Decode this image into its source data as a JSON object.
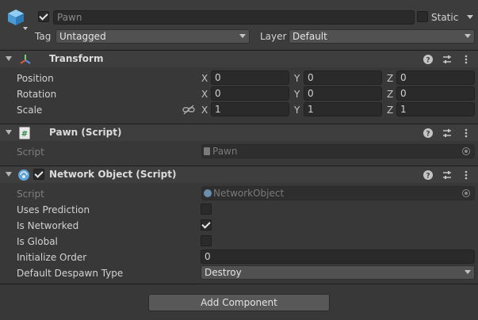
{
  "gameobject": {
    "name": "Pawn",
    "active": true,
    "static_label": "Static",
    "static_checked": false,
    "tag_label": "Tag",
    "tag_value": "Untagged",
    "layer_label": "Layer",
    "layer_value": "Default"
  },
  "transform": {
    "title": "Transform",
    "rows": [
      {
        "label": "Position",
        "x": "0",
        "y": "0",
        "z": "0"
      },
      {
        "label": "Rotation",
        "x": "0",
        "y": "0",
        "z": "0"
      },
      {
        "label": "Scale",
        "x": "1",
        "y": "1",
        "z": "1"
      }
    ],
    "axes": {
      "x": "X",
      "y": "Y",
      "z": "Z"
    }
  },
  "pawn_script": {
    "title": "Pawn (Script)",
    "script_label": "Script",
    "script_value": "Pawn"
  },
  "network_object": {
    "title": "Network Object (Script)",
    "enabled": true,
    "script_label": "Script",
    "script_value": "NetworkObject",
    "uses_prediction_label": "Uses Prediction",
    "uses_prediction": false,
    "is_networked_label": "Is Networked",
    "is_networked": true,
    "is_global_label": "Is Global",
    "is_global": false,
    "initialize_order_label": "Initialize Order",
    "initialize_order": "0",
    "despawn_type_label": "Default Despawn Type",
    "despawn_type": "Destroy"
  },
  "add_component_label": "Add Component",
  "colors": {
    "background": "#383838",
    "header": "#3e3e3e",
    "field": "#2a2a2a",
    "cube_icon": "#5aa9e6",
    "script_icon": "#4fb26a"
  },
  "icons": {
    "gameobject": "cube-icon",
    "transform": "transform-axes-icon",
    "pawn_script": "csharp-script-icon",
    "network_object": "network-object-icon",
    "help": "help-icon",
    "presets": "presets-icon",
    "menu": "kebab-menu-icon",
    "link": "constrain-proportions-icon",
    "object_picker": "object-picker-icon"
  }
}
